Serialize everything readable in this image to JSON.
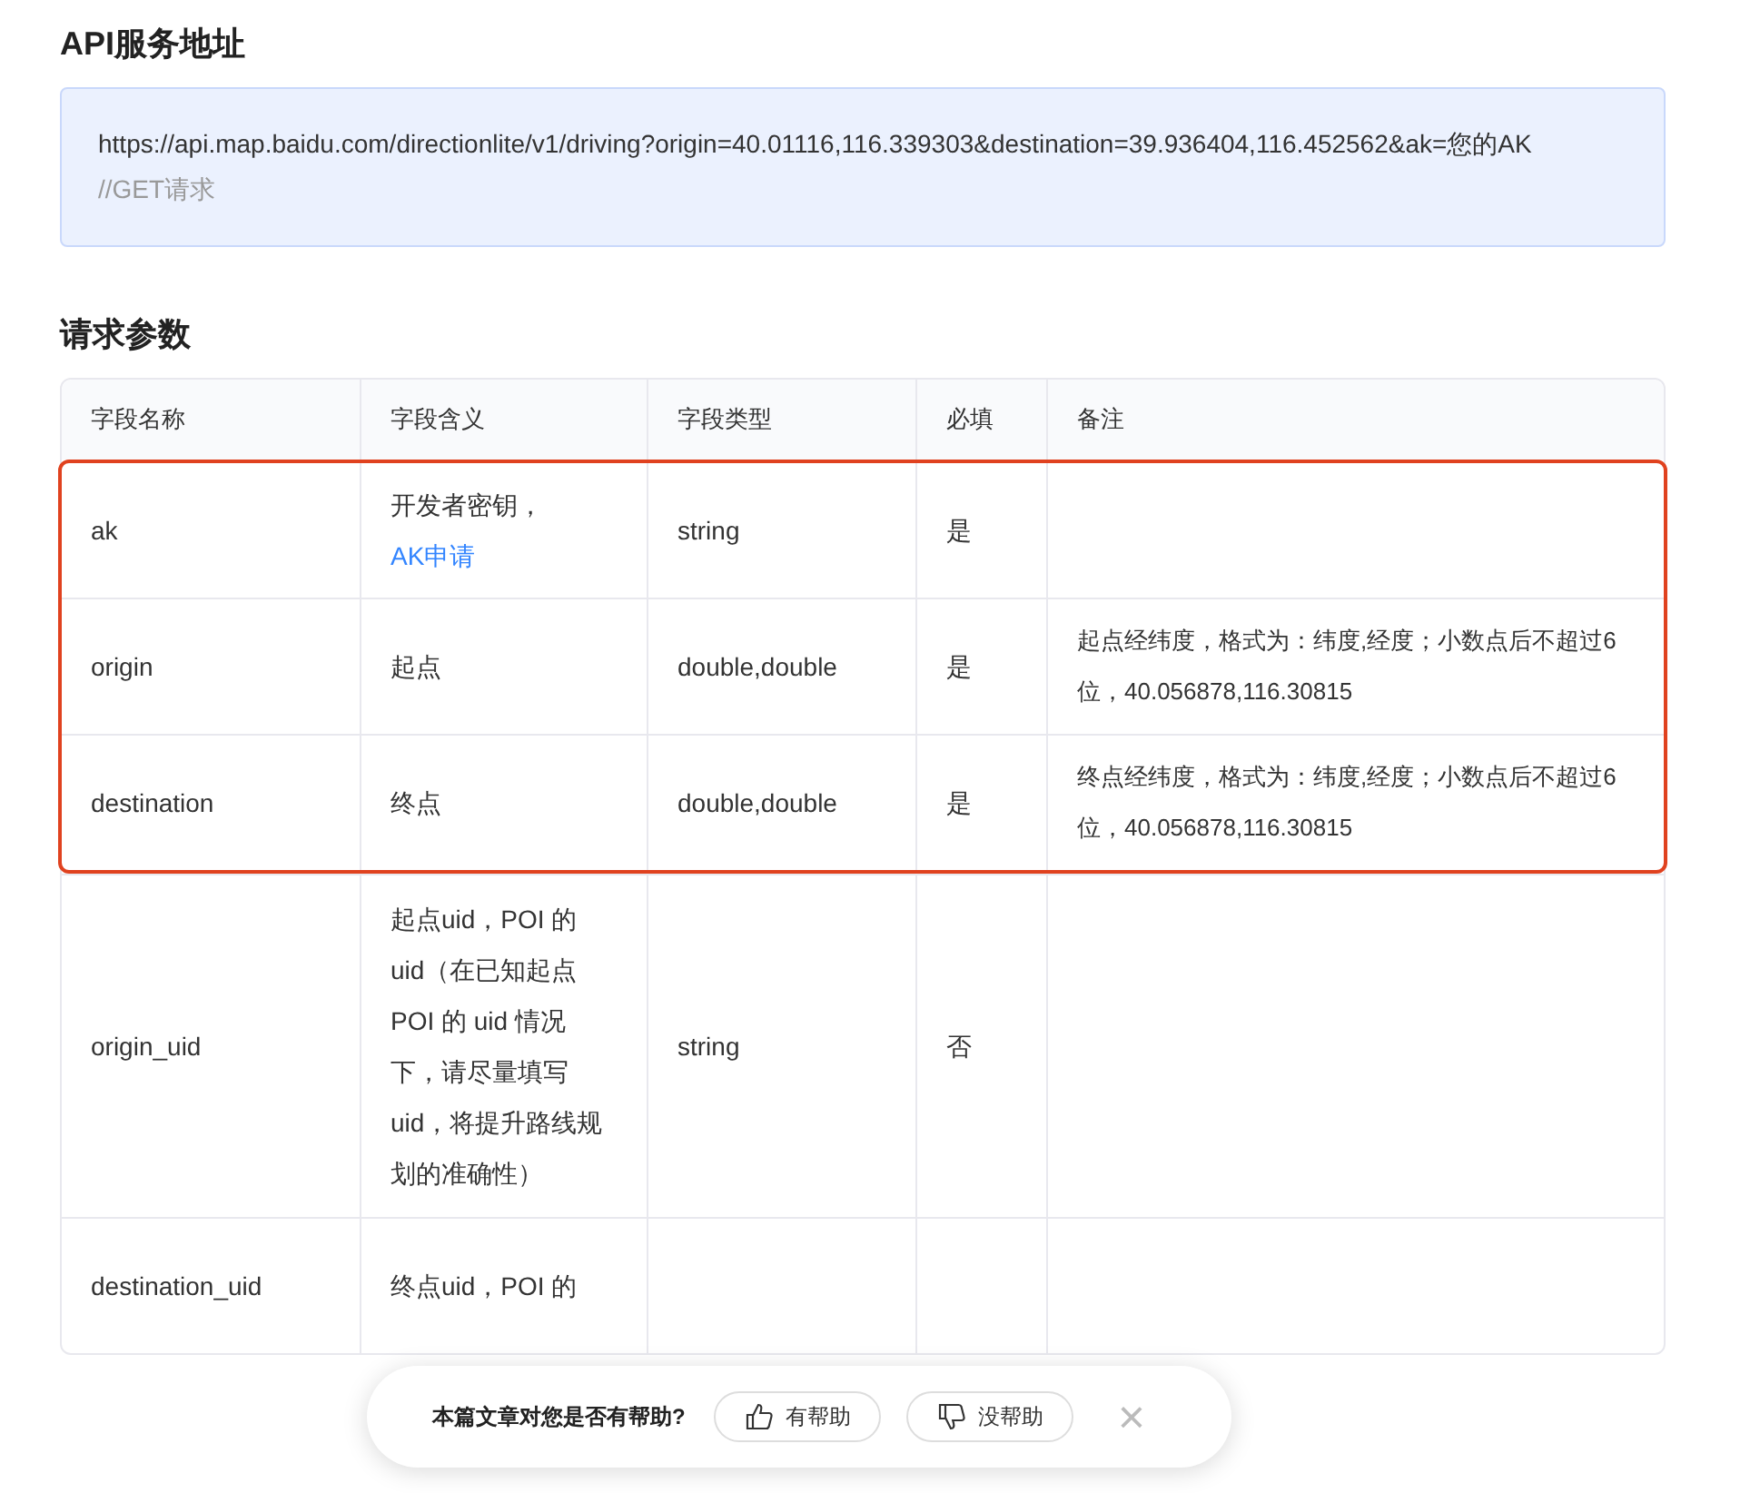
{
  "sections": [
    {
      "title": "API服务地址"
    },
    {
      "title": "请求参数"
    }
  ],
  "request": {
    "url": "https://api.map.baidu.com/directionlite/v1/driving?origin=40.01116,116.339303&destination=39.936404,116.452562&ak=您的AK",
    "comment": "//GET请求"
  },
  "table": {
    "columns": [
      "字段名称",
      "字段含义",
      "字段类型",
      "必填",
      "备注"
    ],
    "rows": [
      {
        "name": "ak",
        "meaning": [
          "开发者密钥，"
        ],
        "link": "AK申请",
        "type": "string",
        "required": "是",
        "note": "",
        "highlighted": true
      },
      {
        "name": "origin",
        "meaning": [
          "起点"
        ],
        "type": "double,double",
        "required": "是",
        "note": "起点经纬度，格式为：纬度,经度；小数点后不超过6位，40.056878,116.30815",
        "highlighted": true
      },
      {
        "name": "destination",
        "meaning": [
          "终点"
        ],
        "type": "double,double",
        "required": "是",
        "note": "终点经纬度，格式为：纬度,经度；小数点后不超过6位，40.056878,116.30815",
        "highlighted": true
      },
      {
        "name": "origin_uid",
        "meaning": [
          "起点uid，POI 的",
          "uid（在已知起点",
          "POI 的 uid 情况",
          "下，请尽量填写",
          "uid，将提升路线规",
          "划的准确性）"
        ],
        "type": "string",
        "required": "否",
        "note": "",
        "highlighted": false
      },
      {
        "name": "destination_uid",
        "meaning": [
          "终点uid，POI 的"
        ],
        "type": "",
        "required": "",
        "note": "",
        "highlighted": false
      }
    ]
  },
  "feedback": {
    "question": "本篇文章对您是否有帮助?",
    "buttons": [
      {
        "kind": "up",
        "label": "有帮助"
      },
      {
        "kind": "down",
        "label": "没帮助"
      }
    ],
    "close": "×"
  }
}
